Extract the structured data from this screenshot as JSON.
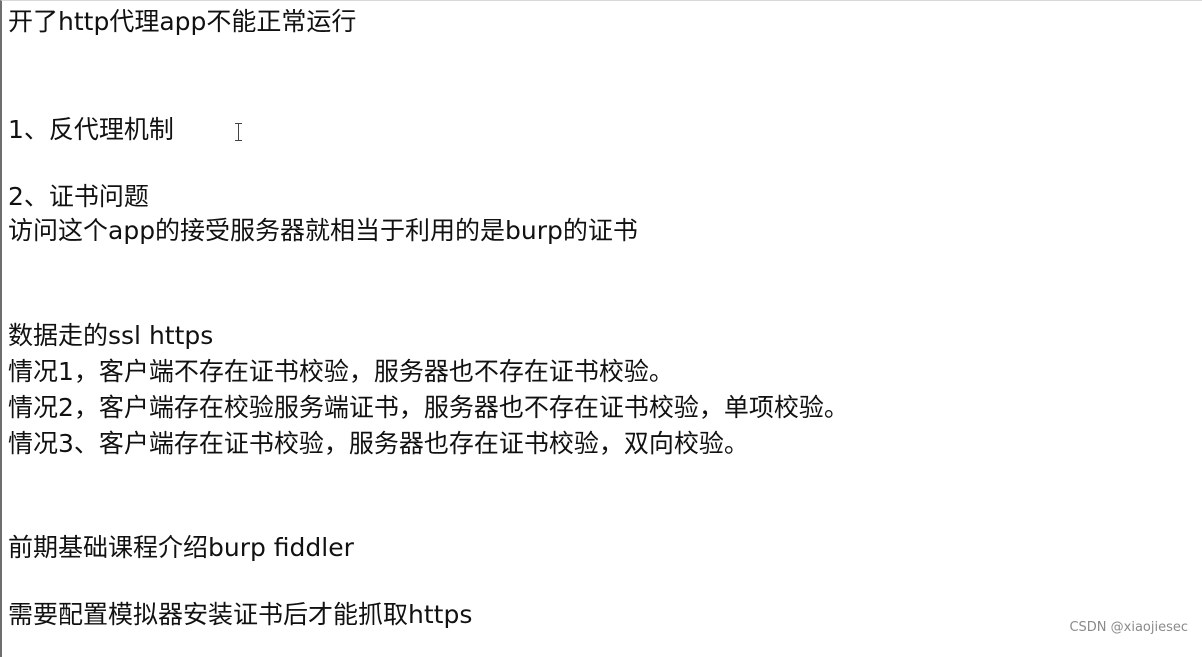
{
  "document": {
    "lines": [
      "开了http代理app不能正常运行",
      "1、反代理机制",
      "2、证书问题",
      "访问这个app的接受服务器就相当于利用的是burp的证书",
      "数据走的ssl https",
      "情况1，客户端不存在证书校验，服务器也不存在证书校验。",
      "情况2，客户端存在校验服务端证书，服务器也不存在证书校验，单项校验。",
      "情况3、客户端存在证书校验，服务器也存在证书校验，双向校验。",
      "前期基础课程介绍burp fiddler",
      "需要配置模拟器安装证书后才能抓取https"
    ]
  },
  "watermark": {
    "text": "CSDN @xiaojiesec"
  }
}
